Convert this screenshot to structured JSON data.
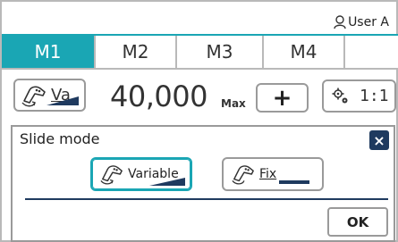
{
  "header": {
    "user_label": "User A"
  },
  "tabs": [
    {
      "label": "M1",
      "active": true
    },
    {
      "label": "M2",
      "active": false
    },
    {
      "label": "M3",
      "active": false
    },
    {
      "label": "M4",
      "active": false
    },
    {
      "label": "",
      "active": false
    }
  ],
  "controls": {
    "mode_label": "Va",
    "speed_value": "40,000",
    "speed_suffix": "Max",
    "plus_label": "+",
    "ratio_value": "1:1"
  },
  "dialog": {
    "title": "Slide mode",
    "close_label": "×",
    "options": [
      {
        "label": "Variable",
        "selected": true
      },
      {
        "label": "Fix",
        "selected": false
      }
    ],
    "ok_label": "OK"
  },
  "colors": {
    "accent": "#1aa6b4",
    "dark_navy": "#1f3a5f",
    "border_gray": "#9a9a9a"
  }
}
